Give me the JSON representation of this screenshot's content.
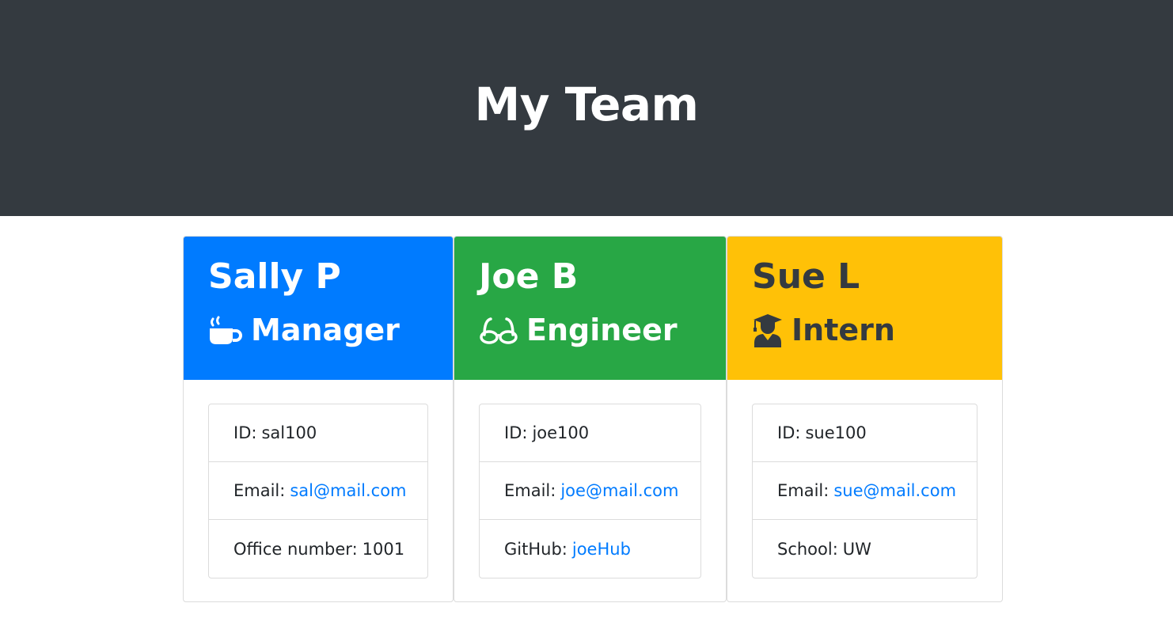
{
  "header": {
    "title": "My Team"
  },
  "colors": {
    "manager": "#007bff",
    "engineer": "#28a745",
    "intern": "#ffc107",
    "jumbotron": "#343a40",
    "link": "#007bff"
  },
  "cards": [
    {
      "name": "Sally P",
      "role": "Manager",
      "icon": "mug-hot-icon",
      "id_label": "ID:",
      "id_value": "sal100",
      "email_label": "Email:",
      "email_value": "sal@mail.com",
      "extra_label": "Office number:",
      "extra_value": "1001"
    },
    {
      "name": "Joe B",
      "role": "Engineer",
      "icon": "glasses-icon",
      "id_label": "ID:",
      "id_value": "joe100",
      "email_label": "Email:",
      "email_value": "joe@mail.com",
      "extra_label": "GitHub:",
      "extra_value": "joeHub"
    },
    {
      "name": "Sue L",
      "role": "Intern",
      "icon": "user-graduate-icon",
      "id_label": "ID:",
      "id_value": "sue100",
      "email_label": "Email:",
      "email_value": "sue@mail.com",
      "extra_label": "School:",
      "extra_value": "UW"
    }
  ]
}
